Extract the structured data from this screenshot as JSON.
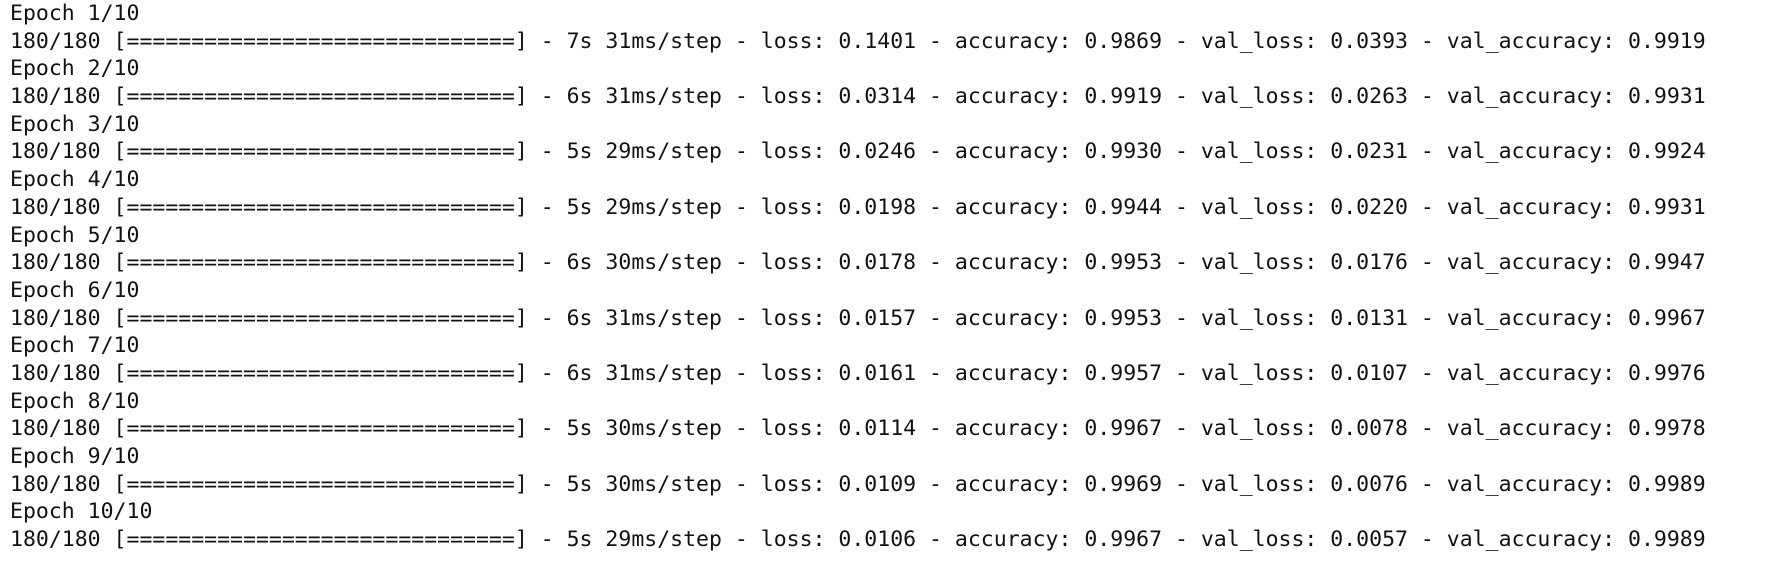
{
  "log": [
    {
      "epoch": "Epoch 1/10",
      "progress": "180/180 [==============================] - 7s 31ms/step - loss: 0.1401 - accuracy: 0.9869 - val_loss: 0.0393 - val_accuracy: 0.9919"
    },
    {
      "epoch": "Epoch 2/10",
      "progress": "180/180 [==============================] - 6s 31ms/step - loss: 0.0314 - accuracy: 0.9919 - val_loss: 0.0263 - val_accuracy: 0.9931"
    },
    {
      "epoch": "Epoch 3/10",
      "progress": "180/180 [==============================] - 5s 29ms/step - loss: 0.0246 - accuracy: 0.9930 - val_loss: 0.0231 - val_accuracy: 0.9924"
    },
    {
      "epoch": "Epoch 4/10",
      "progress": "180/180 [==============================] - 5s 29ms/step - loss: 0.0198 - accuracy: 0.9944 - val_loss: 0.0220 - val_accuracy: 0.9931"
    },
    {
      "epoch": "Epoch 5/10",
      "progress": "180/180 [==============================] - 6s 30ms/step - loss: 0.0178 - accuracy: 0.9953 - val_loss: 0.0176 - val_accuracy: 0.9947"
    },
    {
      "epoch": "Epoch 6/10",
      "progress": "180/180 [==============================] - 6s 31ms/step - loss: 0.0157 - accuracy: 0.9953 - val_loss: 0.0131 - val_accuracy: 0.9967"
    },
    {
      "epoch": "Epoch 7/10",
      "progress": "180/180 [==============================] - 6s 31ms/step - loss: 0.0161 - accuracy: 0.9957 - val_loss: 0.0107 - val_accuracy: 0.9976"
    },
    {
      "epoch": "Epoch 8/10",
      "progress": "180/180 [==============================] - 5s 30ms/step - loss: 0.0114 - accuracy: 0.9967 - val_loss: 0.0078 - val_accuracy: 0.9978"
    },
    {
      "epoch": "Epoch 9/10",
      "progress": "180/180 [==============================] - 5s 30ms/step - loss: 0.0109 - accuracy: 0.9969 - val_loss: 0.0076 - val_accuracy: 0.9989"
    },
    {
      "epoch": "Epoch 10/10",
      "progress": "180/180 [==============================] - 5s 29ms/step - loss: 0.0106 - accuracy: 0.9967 - val_loss: 0.0057 - val_accuracy: 0.9989"
    }
  ],
  "colors": {
    "background": "#ffffff",
    "text": "#111111"
  }
}
